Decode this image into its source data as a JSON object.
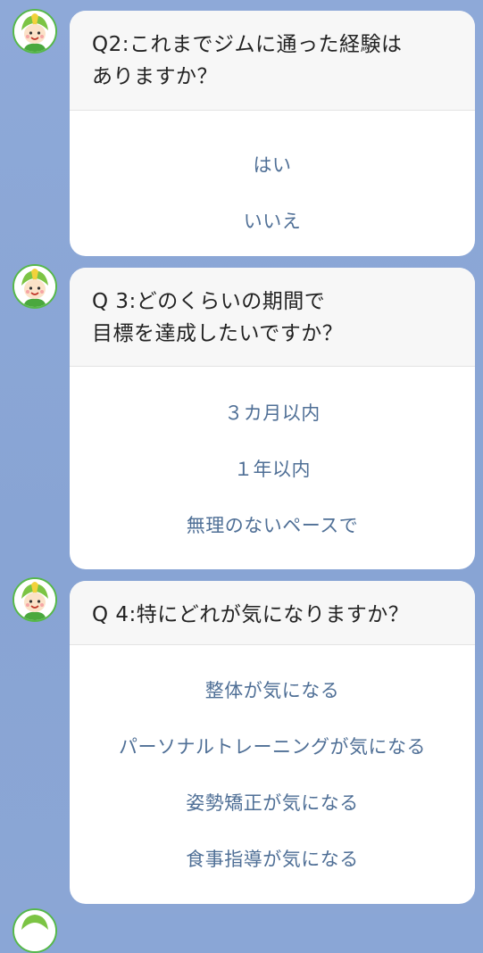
{
  "questions": [
    {
      "title": "Q2:これまでジムに通った経験は\nありますか？",
      "options": [
        "はい",
        "いいえ"
      ]
    },
    {
      "title": "Q 3:どのくらいの期間で\n目標を達成したいですか？",
      "options": [
        "３カ月以内",
        "１年以内",
        "無理のないペースで"
      ]
    },
    {
      "title": "Q 4:特にどれが気になりますか？",
      "options": [
        "整体が気になる",
        "パーソナルトレーニングが気になる",
        "姿勢矯正が気になる",
        "食事指導が気になる"
      ]
    }
  ],
  "colors": {
    "background": "#8aa6d6",
    "option_text": "#4f6f96",
    "avatar_green": "#56b84a"
  },
  "icons": {
    "avatar": "mascot-avatar-icon"
  }
}
